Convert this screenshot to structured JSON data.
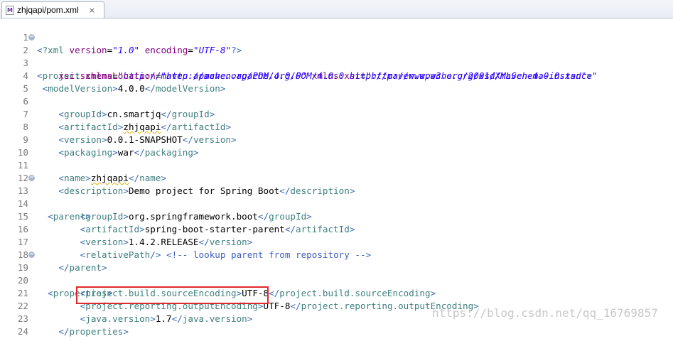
{
  "tab": {
    "title": "zhjqapi/pom.xml",
    "icon": "xml-file-icon",
    "close": "×",
    "icon_letter": "M"
  },
  "lines": [
    {
      "n": "1"
    },
    {
      "n": "2"
    },
    {
      "n": "3"
    },
    {
      "n": "4"
    },
    {
      "n": "5"
    },
    {
      "n": "6"
    },
    {
      "n": "7"
    },
    {
      "n": "8"
    },
    {
      "n": "9"
    },
    {
      "n": "10"
    },
    {
      "n": "11"
    },
    {
      "n": "12"
    },
    {
      "n": "13"
    },
    {
      "n": "14"
    },
    {
      "n": "15"
    },
    {
      "n": "16"
    },
    {
      "n": "17"
    },
    {
      "n": "18"
    },
    {
      "n": "19"
    },
    {
      "n": "20"
    },
    {
      "n": "21"
    },
    {
      "n": "22"
    },
    {
      "n": "23"
    },
    {
      "n": "24"
    }
  ],
  "code": {
    "l1_decl": "?xml",
    "l1_version_attr": "version",
    "l1_version_val": "\"1.0\"",
    "l1_enc_attr": "encoding",
    "l1_enc_val": "\"UTF-8\"",
    "l2_tag": "project",
    "l2_xmlns_attr": "xmlns",
    "l2_xmlns_val": "\"http://maven.apache.org/POM/4.0.0\"",
    "l2_xsi_attr": "xmlns:xsi",
    "l2_xsi_val": "\"http://www.w3.org/2001/XMLSchema-instance\"",
    "l3_attr": "xsi:schemaLocation",
    "l3_val": "\"http://maven.apache.org/POM/4.0.0 http://maven.apache.org/xsd/maven-4.0.0.xsd\"",
    "modelVersion_tag": "modelVersion",
    "modelVersion_val": "4.0.0",
    "groupId_tag": "groupId",
    "groupId_val": "cn.smartjq",
    "artifactId_tag": "artifactId",
    "artifactId_val": "zhjqapi",
    "version_tag": "version",
    "version_val": "0.0.1-SNAPSHOT",
    "packaging_tag": "packaging",
    "packaging_val": "war",
    "name_tag": "name",
    "name_val": "zhjqapi",
    "description_tag": "description",
    "description_val": "Demo project for Spring Boot",
    "parent_tag": "parent",
    "p_groupId_val": "org.springframework.boot",
    "p_artifactId_val": "spring-boot-starter-parent",
    "p_version_val": "1.4.2.RELEASE",
    "relativePath_tag": "relativePath",
    "relativePath_comment": "<!-- lookup parent from repository -->",
    "properties_tag": "properties",
    "src_enc_tag": "project.build.sourceEncoding",
    "src_enc_val": "UTF-8",
    "rep_enc_tag": "project.reporting.outputEncoding",
    "rep_enc_val": "UTF-8",
    "java_tag": "java.version",
    "java_val": "1.7"
  },
  "watermark": "https://blog.csdn.net/qq_16769857"
}
